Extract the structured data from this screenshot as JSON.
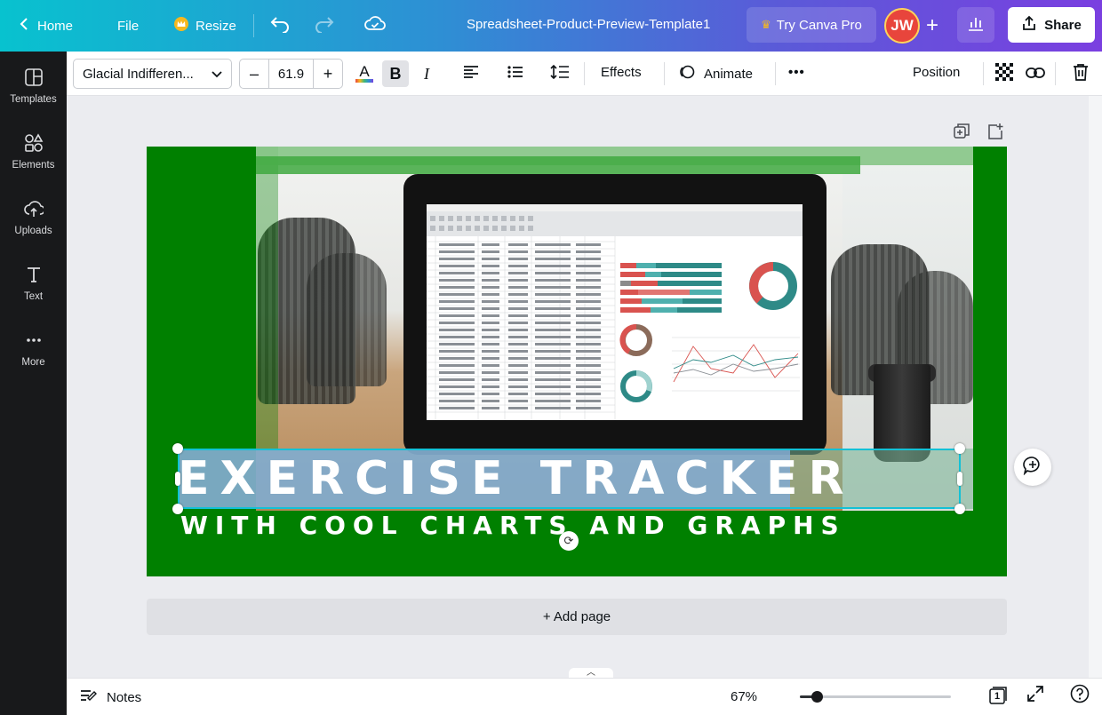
{
  "topbar": {
    "home_label": "Home",
    "file_label": "File",
    "resize_label": "Resize",
    "doc_title": "Spreadsheet-Product-Preview-Template1",
    "pro_label": "Try Canva Pro",
    "avatar_initials": "JW",
    "share_label": "Share",
    "crown_icon": "crown-icon",
    "accent_colors": {
      "gradient_start": "#08c2cf",
      "gradient_end": "#7a3fe0",
      "crown": "#f6b81f"
    }
  },
  "sidebar": {
    "items": [
      {
        "label": "Templates",
        "icon": "templates-icon"
      },
      {
        "label": "Elements",
        "icon": "elements-icon"
      },
      {
        "label": "Uploads",
        "icon": "uploads-icon"
      },
      {
        "label": "Text",
        "icon": "text-icon"
      },
      {
        "label": "More",
        "icon": "more-icon"
      }
    ]
  },
  "toolbar": {
    "font_name": "Glacial Indifferen...",
    "size_minus": "–",
    "font_size": "61.9",
    "size_plus": "+",
    "text_color_glyph": "A",
    "bold_glyph": "B",
    "italic_glyph": "I",
    "effects_label": "Effects",
    "animate_label": "Animate",
    "more_glyph": "•••",
    "position_label": "Position"
  },
  "design": {
    "title": "EXERCISE TRACKER",
    "subtitle": "WITH COOL CHARTS AND GRAPHS",
    "background_color": "#008000"
  },
  "canvas": {
    "add_page_label": "+ Add page"
  },
  "bottombar": {
    "notes_label": "Notes",
    "zoom_label": "67%",
    "zoom_fraction": 0.11,
    "page_count": "1"
  }
}
